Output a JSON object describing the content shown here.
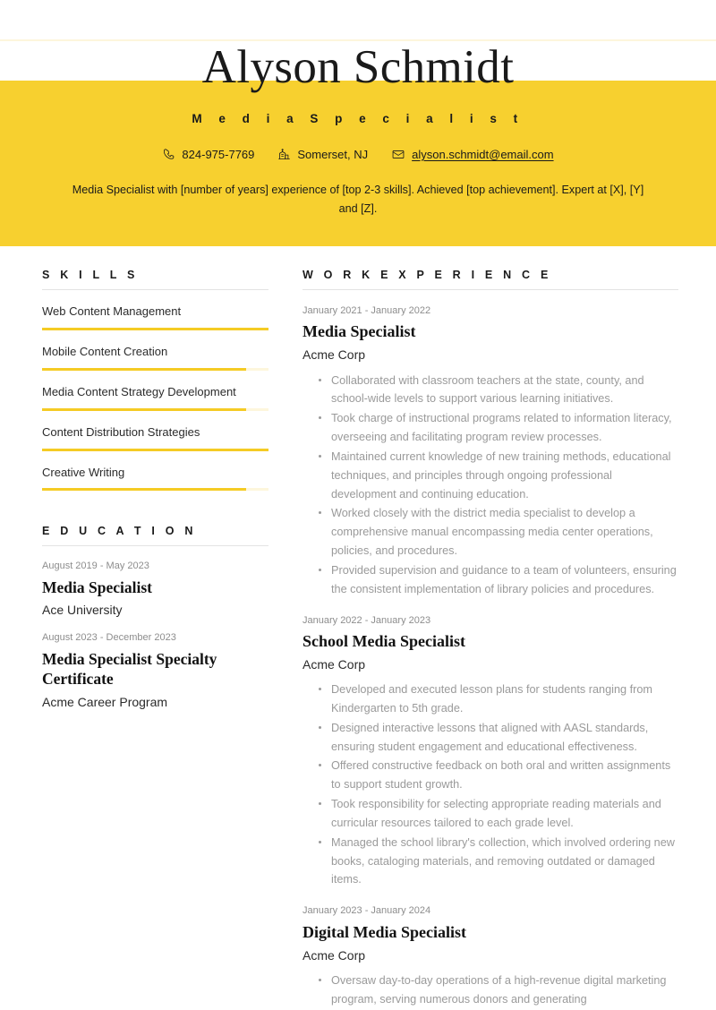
{
  "header": {
    "name": "Alyson Schmidt",
    "job_title": "M e d i a   S p e c i a l i s t",
    "phone": "824-975-7769",
    "location": "Somerset, NJ",
    "email": "alyson.schmidt@email.com",
    "summary": "Media Specialist with [number of years] experience of [top 2-3 skills]. Achieved [top achievement]. Expert at [X], [Y] and [Z].",
    "band_color": "#F7D02F"
  },
  "skills": {
    "title": "S K I L L S",
    "items": [
      {
        "name": "Web Content Management",
        "level": 100
      },
      {
        "name": "Mobile Content Creation",
        "level": 90
      },
      {
        "name": "Media Content Strategy Development",
        "level": 90
      },
      {
        "name": "Content Distribution Strategies",
        "level": 100
      },
      {
        "name": "Creative Writing",
        "level": 90
      }
    ],
    "bar_color": "#F5CB24",
    "track_color": "#FDF6DC"
  },
  "education": {
    "title": "E D U C A T I O N",
    "items": [
      {
        "date": "August 2019 - May 2023",
        "title": "Media Specialist",
        "org": "Ace University"
      },
      {
        "date": "August 2023 - December 2023",
        "title": "Media Specialist Specialty Certificate",
        "org": "Acme Career Program"
      }
    ]
  },
  "work_experience": {
    "title": "W O R K   E X P E R I E N C E",
    "jobs": [
      {
        "date": "January 2021 - January 2022",
        "title": "Media Specialist",
        "org": "Acme Corp",
        "bullets": [
          "Collaborated with classroom teachers at the state, county, and school-wide levels to support various learning initiatives.",
          "Took charge of instructional programs related to information literacy, overseeing and facilitating program review processes.",
          "Maintained current knowledge of new training methods, educational techniques, and principles through ongoing professional development and continuing education.",
          "Worked closely with the district media specialist to develop a comprehensive manual encompassing media center operations, policies, and procedures.",
          "Provided supervision and guidance to a team of volunteers, ensuring the consistent implementation of library policies and procedures."
        ]
      },
      {
        "date": "January 2022 - January 2023",
        "title": "School Media Specialist",
        "org": "Acme Corp",
        "bullets": [
          "Developed and executed lesson plans for students ranging from Kindergarten to 5th grade.",
          "Designed interactive lessons that aligned with AASL standards, ensuring student engagement and educational effectiveness.",
          "Offered constructive feedback on both oral and written assignments to support student growth.",
          "Took responsibility for selecting appropriate reading materials and curricular resources tailored to each grade level.",
          "Managed the school library's collection, which involved ordering new books, cataloging materials, and removing outdated or damaged items."
        ]
      },
      {
        "date": "January 2023 - January 2024",
        "title": "Digital Media Specialist",
        "org": "Acme Corp",
        "bullets": [
          "Oversaw day-to-day operations of a high-revenue digital marketing program, serving numerous donors and generating"
        ]
      }
    ]
  }
}
